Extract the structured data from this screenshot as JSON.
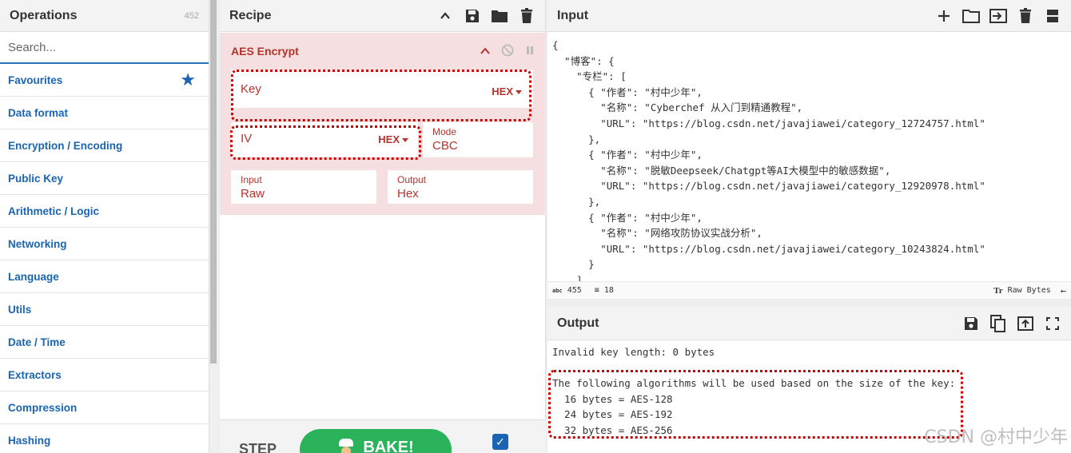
{
  "operations": {
    "title": "Operations",
    "count": "452",
    "search_placeholder": "Search...",
    "categories": [
      "Favourites",
      "Data format",
      "Encryption / Encoding",
      "Public Key",
      "Arithmetic / Logic",
      "Networking",
      "Language",
      "Utils",
      "Date / Time",
      "Extractors",
      "Compression",
      "Hashing"
    ]
  },
  "recipe": {
    "title": "Recipe",
    "operation": {
      "title": "AES Encrypt",
      "key_placeholder": "Key",
      "key_format": "HEX",
      "iv_placeholder": "IV",
      "iv_format": "HEX",
      "mode_label": "Mode",
      "mode_value": "CBC",
      "input_label": "Input",
      "input_value": "Raw",
      "output_label": "Output",
      "output_value": "Hex"
    },
    "step_label": "STEP",
    "bake_label": "BAKE!"
  },
  "input": {
    "title": "Input",
    "lines": [
      "{",
      "  \"博客\": {",
      "    \"专栏\": [",
      "      { \"作者\": \"村中少年\",",
      "        \"名称\": \"Cyberchef 从入门到精通教程\",",
      "        \"URL\": \"https://blog.csdn.net/javajiawei/category_12724757.html\"",
      "      },",
      "      { \"作者\": \"村中少年\",",
      "        \"名称\": \"脱敏Deepseek/Chatgpt等AI大模型中的敏感数据\",",
      "        \"URL\": \"https://blog.csdn.net/javajiawei/category_12920978.html\"",
      "      },",
      "      { \"作者\": \"村中少年\",",
      "        \"名称\": \"网络攻防协议实战分析\",",
      "        \"URL\": \"https://blog.csdn.net/javajiawei/category_10243824.html\"",
      "      }",
      "    ]"
    ],
    "status": {
      "length_label": "abc",
      "length": "455",
      "lines_count": "18",
      "encoding": "Raw Bytes"
    }
  },
  "output": {
    "title": "Output",
    "line1": "Invalid key length: 0 bytes",
    "line2": "The following algorithms will be used based on the size of the key:",
    "line3": "  16 bytes = AES-128",
    "line4": "  24 bytes = AES-192",
    "line5": "  32 bytes = AES-256"
  },
  "watermark": "CSDN @村中少年",
  "colors": {
    "accent_blue": "#1a65b3",
    "recipe_red": "#b4342c",
    "card_bg": "#f5dfe0",
    "bake_green": "#2ab35a",
    "highlight_dotted": "#cc0000"
  }
}
